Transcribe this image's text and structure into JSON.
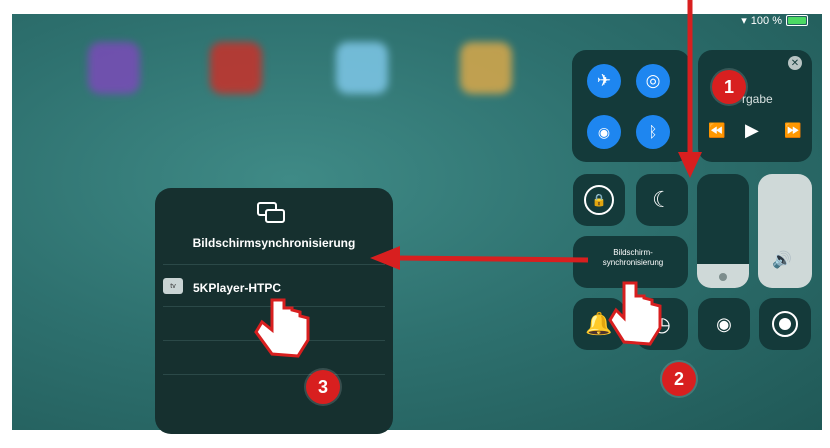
{
  "status": {
    "battery_text": "100 %"
  },
  "control_center": {
    "connectivity": {
      "airplane": "airplane-icon",
      "airdrop": "airdrop-icon",
      "wifi": "wifi-icon",
      "bluetooth": "bluetooth-icon"
    },
    "media": {
      "title_fragment": "rgabe"
    },
    "screen_mirroring_label_line1": "Bildschirm-",
    "screen_mirroring_label_line2": "synchronisierung"
  },
  "mirroring_popup": {
    "title": "Bildschirmsynchronisierung",
    "device_icon_text": "tv",
    "device": "5KPlayer-HTPC"
  },
  "markers": {
    "step1": "1",
    "step2": "2",
    "step3": "3"
  },
  "colors": {
    "arrow": "#d81f1f",
    "accent_blue": "#1e86f0",
    "tile": "#143a3a"
  }
}
